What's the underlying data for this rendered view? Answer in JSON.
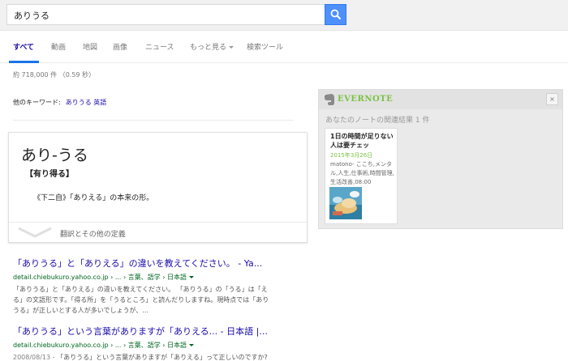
{
  "search": {
    "query": "ありうる"
  },
  "tabs": [
    {
      "label": "すべて",
      "active": true
    },
    {
      "label": "動画"
    },
    {
      "label": "地図"
    },
    {
      "label": "画像"
    },
    {
      "label": "ニュース"
    },
    {
      "label": "もっと見る",
      "dropdown": true
    },
    {
      "label": "検索ツール"
    }
  ],
  "result_stats": "約 718,000 件 （0.59 秒）",
  "related": {
    "label": "他のキーワード:",
    "link": "ありうる 英語"
  },
  "dictionary": {
    "word": "あり-うる",
    "reading": "【有り得る】",
    "definition": "《下二自》「ありえる」の本来の形。",
    "more_label": "翻訳とその他の定義"
  },
  "results": [
    {
      "title": "「ありうる」と「ありえる」の違いを教えてください。 - Ya...",
      "url": "detail.chiebukuro.yahoo.co.jp › ... › 言葉、語学 › 日本語",
      "snippet_line1": "「ありうる」と「ありえる」の違いを教えてください。 「ありうる」の「うる」は「え",
      "snippet_line2": "る」の文語形です。「得る所」を「うるところ」と読んだりしますね。現時点では「あり",
      "snippet_line3": "うる」が正しいとする人が多いでしょうが、..."
    },
    {
      "title": "「ありうる」という言葉がありますが「ありえる... - 日本語 |...",
      "url": "detail.chiebukuro.yahoo.co.jp › ... › 言葉、語学 › 日本語",
      "date": "2008/08/13 - ",
      "snippet_line1": "「ありうる」という言葉がありますが「ありえる」って正しいのですか?"
    }
  ],
  "evernote": {
    "brand": "EVERNOTE",
    "close": "×",
    "count_text": "あなたのノートの関連結果 1 件",
    "note": {
      "title": "1日の時間が足りない人は要チェッ",
      "date": "2015年3月26日",
      "snippet": "matono- ここち,メンタル,人生,仕事術,時間管理,生活改善,08:00"
    }
  },
  "colors": {
    "link": "#1a0dab",
    "url_green": "#006621",
    "evernote_green": "#7ac143",
    "search_blue": "#4d90fe",
    "tab_underline": "#1a73e8"
  },
  "icons": {
    "search_button": "search-icon",
    "evernote_logo": "elephant-icon",
    "dictionary_expand": "chevron-down-icon"
  }
}
